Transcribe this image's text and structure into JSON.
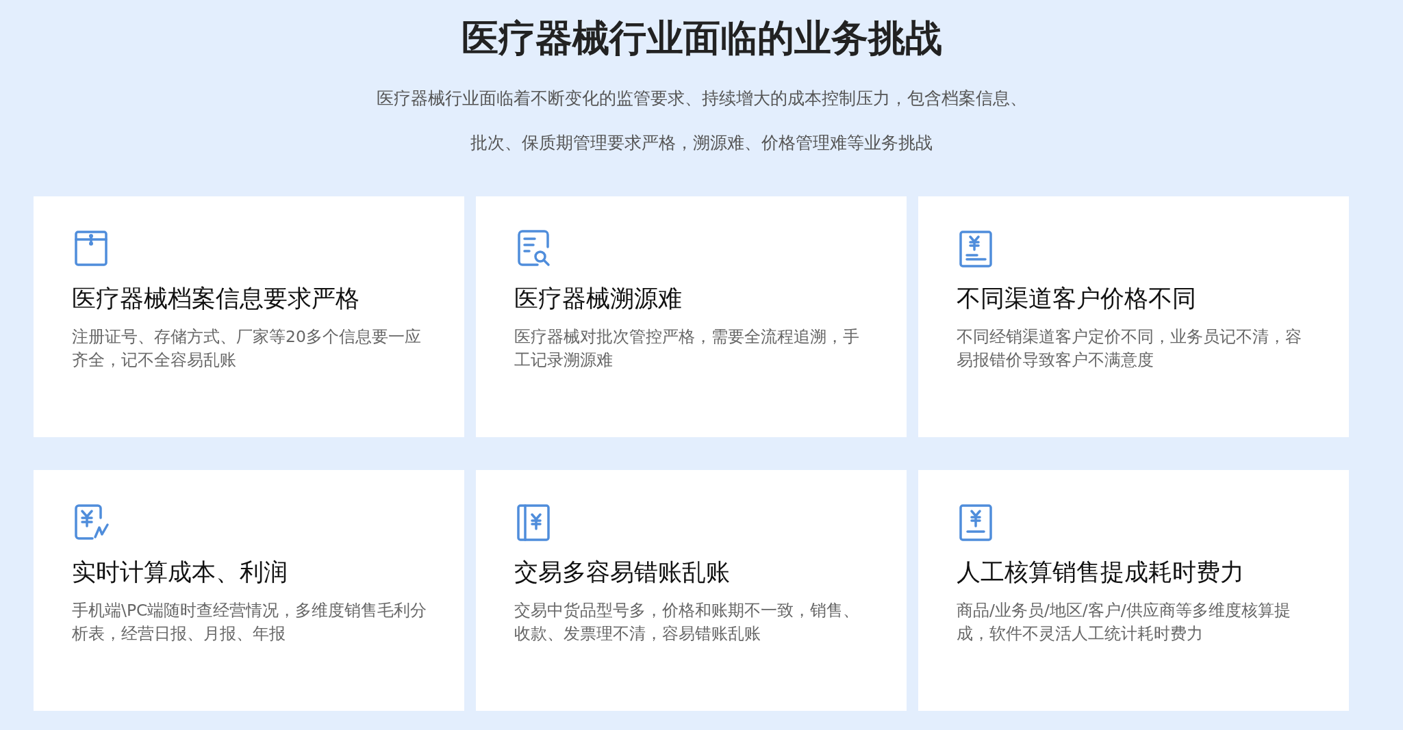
{
  "heading": "医疗器械行业面临的业务挑战",
  "intro": [
    "医疗器械行业面临着不断变化的监管要求、持续增大的成本控制压力，包含档案信息、",
    "批次、保质期管理要求严格，溯源难、价格管理难等业务挑战"
  ],
  "cards": [
    {
      "kind": "archive",
      "title": "医疗器械档案信息要求严格",
      "text": "注册证号、存储方式、厂家等20多个信息要一应齐全，记不全容易乱账"
    },
    {
      "kind": "search",
      "title": "医疗器械溯源难",
      "text": "医疗器械对批次管控严格，需要全流程追溯，手工记录溯源难"
    },
    {
      "kind": "price",
      "title": "不同渠道客户价格不同",
      "text": "不同经销渠道客户定价不同，业务员记不清，容易报错价导致客户不满意度"
    },
    {
      "kind": "profit",
      "title": "实时计算成本、利润",
      "text": "手机端\\PC端随时查经营情况，多维度销售毛利分析表，经营日报、月报、年报"
    },
    {
      "kind": "ledger",
      "title": "交易多容易错账乱账",
      "text": "交易中货品型号多，价格和账期不一致，销售、收款、发票理不清，容易错账乱账"
    },
    {
      "kind": "commission",
      "title": "人工核算销售提成耗时费力",
      "text": "商品/业务员/地区/客户/供应商等多维度核算提成，软件不灵活人工统计耗时费力"
    }
  ]
}
